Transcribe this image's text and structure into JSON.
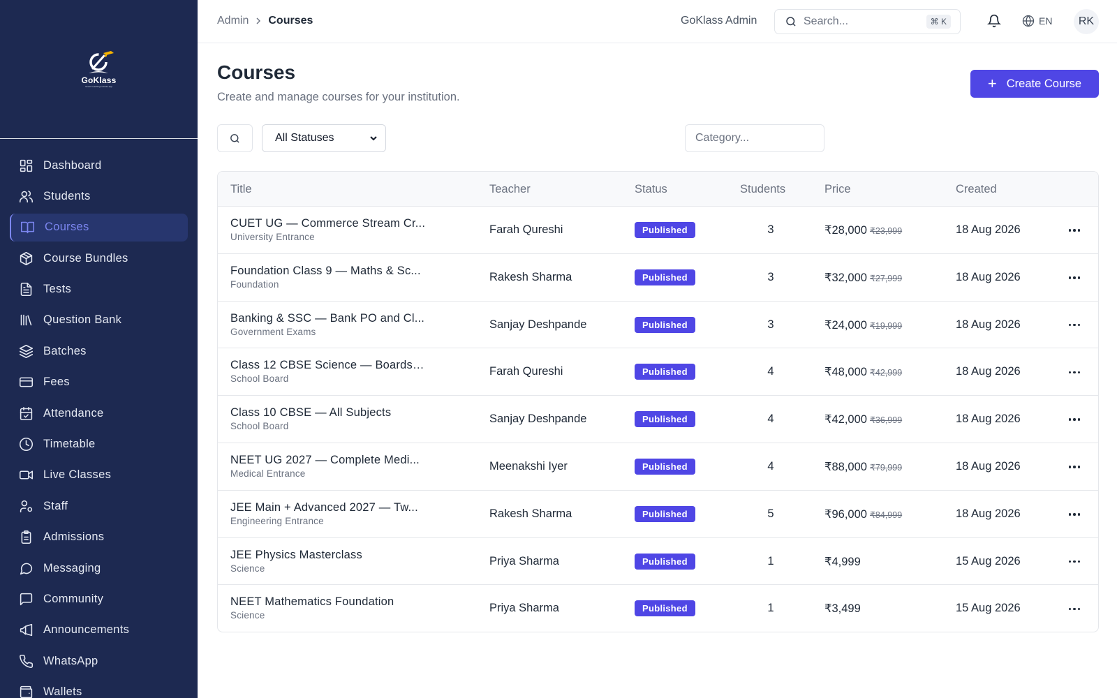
{
  "brand": {
    "name": "GoKlass",
    "tagline": "Smart Coaching Institute App"
  },
  "sidebar": {
    "items": [
      {
        "label": "Dashboard",
        "icon": "dashboard-icon"
      },
      {
        "label": "Students",
        "icon": "users-icon"
      },
      {
        "label": "Courses",
        "icon": "book-open-icon",
        "active": true
      },
      {
        "label": "Course Bundles",
        "icon": "package-icon"
      },
      {
        "label": "Tests",
        "icon": "file-text-icon"
      },
      {
        "label": "Question Bank",
        "icon": "library-icon"
      },
      {
        "label": "Batches",
        "icon": "layers-icon"
      },
      {
        "label": "Fees",
        "icon": "credit-card-icon"
      },
      {
        "label": "Attendance",
        "icon": "calendar-check-icon"
      },
      {
        "label": "Timetable",
        "icon": "clock-icon"
      },
      {
        "label": "Live Classes",
        "icon": "video-icon"
      },
      {
        "label": "Staff",
        "icon": "user-cog-icon"
      },
      {
        "label": "Admissions",
        "icon": "clipboard-icon"
      },
      {
        "label": "Messaging",
        "icon": "message-circle-icon"
      },
      {
        "label": "Community",
        "icon": "message-square-icon"
      },
      {
        "label": "Announcements",
        "icon": "megaphone-icon"
      },
      {
        "label": "WhatsApp",
        "icon": "phone-icon"
      },
      {
        "label": "Wallets",
        "icon": "wallet-icon"
      }
    ]
  },
  "topbar": {
    "breadcrumb": {
      "root": "Admin",
      "current": "Courses"
    },
    "user_name": "GoKlass Admin",
    "search_placeholder": "Search...",
    "search_shortcut": "⌘ K",
    "language": "EN",
    "avatar_initials": "RK"
  },
  "page": {
    "title": "Courses",
    "subtitle": "Create and manage courses for your institution.",
    "create_button": "Create Course"
  },
  "filters": {
    "status_selected": "All Statuses",
    "category_placeholder": "Category..."
  },
  "table": {
    "columns": [
      "Title",
      "Teacher",
      "Status",
      "Students",
      "Price",
      "Created"
    ],
    "rows": [
      {
        "title": "CUET UG — Commerce Stream Cr...",
        "category": "University Entrance",
        "teacher": "Farah Qureshi",
        "status": "Published",
        "students": "3",
        "price": "₹28,000",
        "old_price": "₹23,999",
        "created": "18 Aug 2026"
      },
      {
        "title": "Foundation Class 9 — Maths & Sc...",
        "category": "Foundation",
        "teacher": "Rakesh Sharma",
        "status": "Published",
        "students": "3",
        "price": "₹32,000",
        "old_price": "₹27,999",
        "created": "18 Aug 2026"
      },
      {
        "title": "Banking & SSC — Bank PO and Cl...",
        "category": "Government Exams",
        "teacher": "Sanjay Deshpande",
        "status": "Published",
        "students": "3",
        "price": "₹24,000",
        "old_price": "₹19,999",
        "created": "18 Aug 2026"
      },
      {
        "title": "Class 12 CBSE Science — Boards ...",
        "category": "School Board",
        "teacher": "Farah Qureshi",
        "status": "Published",
        "students": "4",
        "price": "₹48,000",
        "old_price": "₹42,999",
        "created": "18 Aug 2026"
      },
      {
        "title": "Class 10 CBSE — All Subjects",
        "category": "School Board",
        "teacher": "Sanjay Deshpande",
        "status": "Published",
        "students": "4",
        "price": "₹42,000",
        "old_price": "₹36,999",
        "created": "18 Aug 2026"
      },
      {
        "title": "NEET UG 2027 — Complete Medi...",
        "category": "Medical Entrance",
        "teacher": "Meenakshi Iyer",
        "status": "Published",
        "students": "4",
        "price": "₹88,000",
        "old_price": "₹79,999",
        "created": "18 Aug 2026"
      },
      {
        "title": "JEE Main + Advanced 2027 — Tw...",
        "category": "Engineering Entrance",
        "teacher": "Rakesh Sharma",
        "status": "Published",
        "students": "5",
        "price": "₹96,000",
        "old_price": "₹84,999",
        "created": "18 Aug 2026"
      },
      {
        "title": "JEE Physics Masterclass",
        "category": "Science",
        "teacher": "Priya Sharma",
        "status": "Published",
        "students": "1",
        "price": "₹4,999",
        "old_price": "",
        "created": "15 Aug 2026"
      },
      {
        "title": "NEET Mathematics Foundation",
        "category": "Science",
        "teacher": "Priya Sharma",
        "status": "Published",
        "students": "1",
        "price": "₹3,499",
        "old_price": "",
        "created": "15 Aug 2026"
      }
    ]
  },
  "colors": {
    "sidebar_bg": "#1d2951",
    "accent": "#4f46e5",
    "active_nav": "#7c86f0"
  }
}
